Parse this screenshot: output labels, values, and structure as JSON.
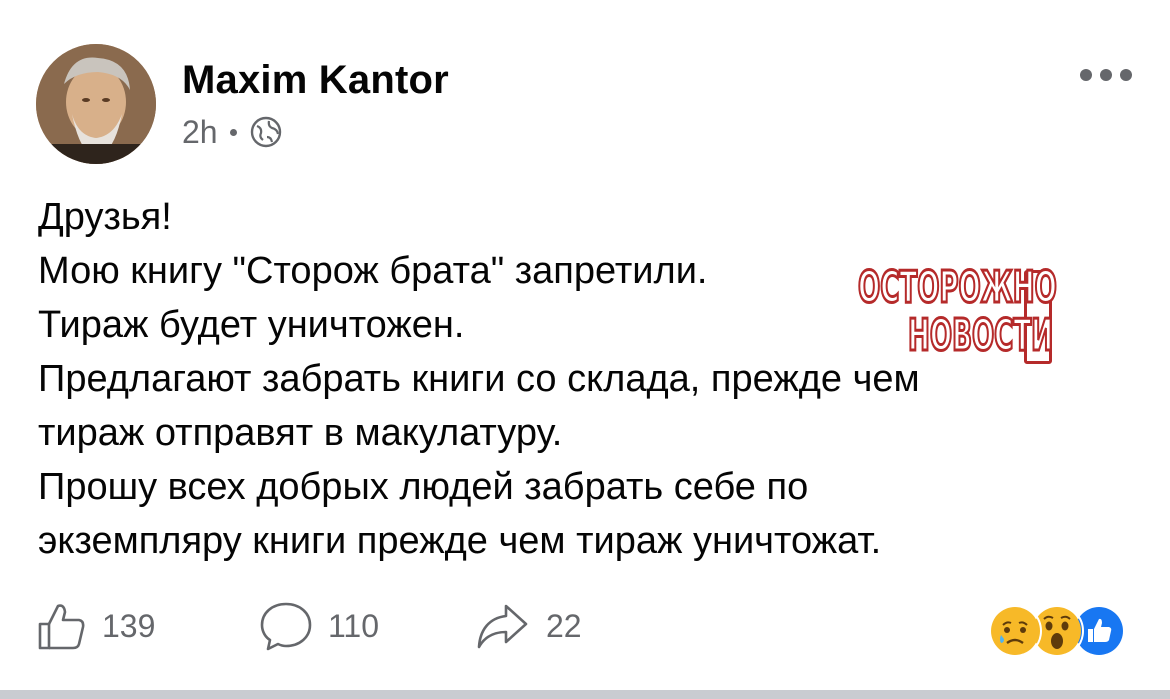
{
  "post": {
    "author": "Maxim Kantor",
    "timestamp": "2h",
    "separator": "·",
    "audience_icon": "globe-icon",
    "more_icon": "more-horizontal-icon",
    "text_lines": [
      "Друзья!",
      "Мою книгу \"Сторож брата\" запретили.",
      "Тираж будет уничтожен.",
      "Предлагают забрать книги со склада, прежде чем",
      "тираж отправят в макулатуру.",
      "Прошу всех добрых людей забрать себе по",
      "экземпляру книги прежде чем тираж уничтожат."
    ]
  },
  "watermark": {
    "line1": "ОСТОРОЖНО",
    "line2": "НОВОСТИ",
    "color": "#b52a2a"
  },
  "actions": {
    "like_count": "139",
    "comment_count": "110",
    "share_count": "22",
    "like_icon": "thumbs-up-icon",
    "comment_icon": "comment-bubble-icon",
    "share_icon": "share-arrow-icon"
  },
  "reactions": [
    "sad-reaction-icon",
    "wow-reaction-icon",
    "like-reaction-icon"
  ],
  "colors": {
    "text": "#050505",
    "secondary": "#65676b",
    "facebook_blue": "#1877f2",
    "reaction_yellow": "#f7b928",
    "divider": "#c9ccd1"
  }
}
